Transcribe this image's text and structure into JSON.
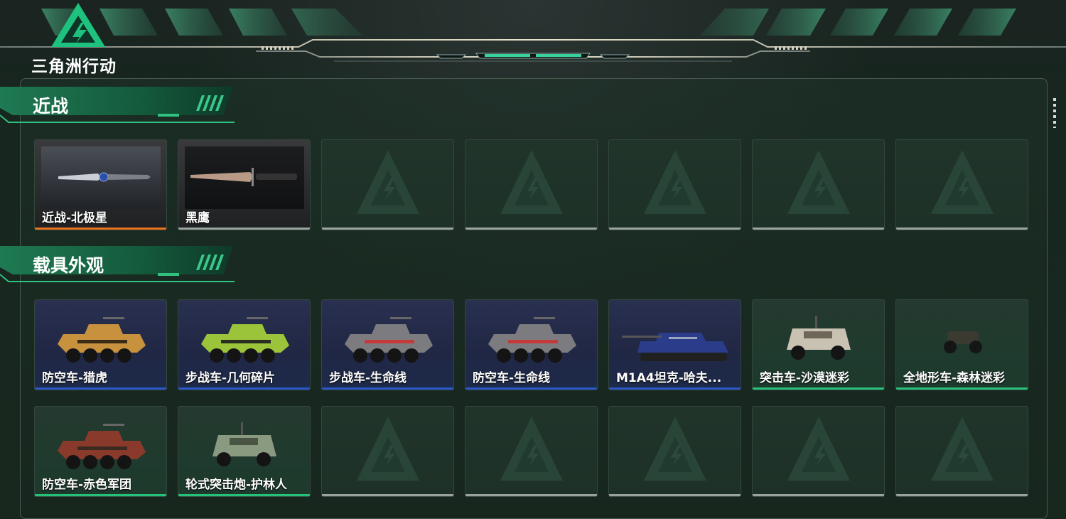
{
  "app": {
    "title": "三角洲行动"
  },
  "colors": {
    "accent_green": "#2ec27e",
    "rarity_orange": "#e8731c",
    "rarity_blue": "#2b56c8",
    "rarity_green": "#27c27a",
    "empty_bar": "#9aa3a0"
  },
  "sections": [
    {
      "title": "近战",
      "rows": [
        [
          {
            "label": "近战-北极星",
            "rarity": "orange",
            "icon": "knife-polaris"
          },
          {
            "label": "黑鹰",
            "rarity": "gray",
            "icon": "knife-blackhawk"
          },
          {
            "label": "",
            "rarity": "empty",
            "icon": "placeholder-logo-icon"
          },
          {
            "label": "",
            "rarity": "empty",
            "icon": "placeholder-logo-icon"
          },
          {
            "label": "",
            "rarity": "empty",
            "icon": "placeholder-logo-icon"
          },
          {
            "label": "",
            "rarity": "empty",
            "icon": "placeholder-logo-icon"
          },
          {
            "label": "",
            "rarity": "empty",
            "icon": "placeholder-logo-icon"
          }
        ]
      ]
    },
    {
      "title": "载具外观",
      "rows": [
        [
          {
            "label": "防空车-猎虎",
            "rarity": "blue",
            "icon": "apc-tiger"
          },
          {
            "label": "步战车-几何碎片",
            "rarity": "blue",
            "icon": "apc-geometric"
          },
          {
            "label": "步战车-生命线",
            "rarity": "blue",
            "icon": "apc-lifeline"
          },
          {
            "label": "防空车-生命线",
            "rarity": "blue",
            "icon": "apc-lifeline-aa"
          },
          {
            "label": "M1A4坦克-哈夫...",
            "rarity": "blue",
            "icon": "tank-m1a4"
          },
          {
            "label": "突击车-沙漠迷彩",
            "rarity": "green",
            "icon": "assault-car-desert"
          },
          {
            "label": "全地形车-森林迷彩",
            "rarity": "green",
            "icon": "atv-forest"
          }
        ],
        [
          {
            "label": "防空车-赤色军团",
            "rarity": "green",
            "icon": "apc-red-legion"
          },
          {
            "label": "轮式突击炮-护林人",
            "rarity": "green",
            "icon": "wheeled-gun-ranger"
          },
          {
            "label": "",
            "rarity": "empty",
            "icon": "placeholder-logo-icon"
          },
          {
            "label": "",
            "rarity": "empty",
            "icon": "placeholder-logo-icon"
          },
          {
            "label": "",
            "rarity": "empty",
            "icon": "placeholder-logo-icon"
          },
          {
            "label": "",
            "rarity": "empty",
            "icon": "placeholder-logo-icon"
          },
          {
            "label": "",
            "rarity": "empty",
            "icon": "placeholder-logo-icon"
          }
        ]
      ]
    }
  ]
}
